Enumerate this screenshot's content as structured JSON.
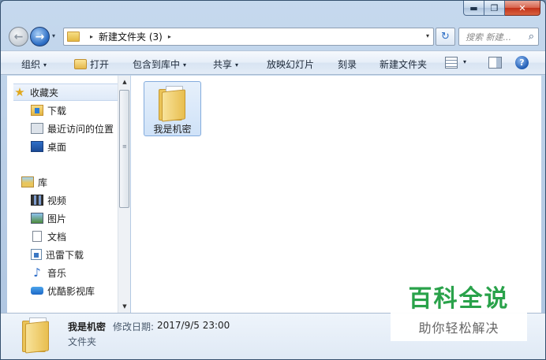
{
  "window": {
    "minimize_glyph": "▬",
    "maximize_glyph": "❐",
    "close_glyph": "✕"
  },
  "address_bar": {
    "path": "新建文件夹 (3)",
    "separator_glyph": "▸",
    "dropdown_glyph": "▾"
  },
  "search": {
    "placeholder": "搜索 新建..."
  },
  "toolbar": {
    "organize": "组织",
    "open": "打开",
    "include_in_library": "包含到库中",
    "share": "共享",
    "slideshow": "放映幻灯片",
    "burn": "刻录",
    "new_folder": "新建文件夹",
    "help_glyph": "?",
    "caret_glyph": "▾"
  },
  "nav_pane": {
    "favorites": {
      "label": "收藏夹",
      "items": [
        {
          "label": "下载",
          "icon": "download-folder-icon"
        },
        {
          "label": "最近访问的位置",
          "icon": "recent-places-icon"
        },
        {
          "label": "桌面",
          "icon": "desktop-icon"
        }
      ]
    },
    "libraries": {
      "label": "库",
      "items": [
        {
          "label": "视频",
          "icon": "video-library-icon"
        },
        {
          "label": "图片",
          "icon": "picture-library-icon"
        },
        {
          "label": "文档",
          "icon": "document-library-icon"
        },
        {
          "label": "迅雷下载",
          "icon": "thunder-download-icon"
        },
        {
          "label": "音乐",
          "icon": "music-library-icon"
        },
        {
          "label": "优酷影视库",
          "icon": "youku-library-icon"
        }
      ]
    }
  },
  "files": [
    {
      "name": "我是机密",
      "type": "folder",
      "selected": true
    }
  ],
  "details": {
    "name": "我是机密",
    "modified_label": "修改日期:",
    "modified_value": "2017/9/5 23:00",
    "type": "文件夹"
  },
  "watermark": {
    "title": "百科全说",
    "subtitle": "助你轻松解决"
  },
  "colors": {
    "frame": "#b6cbe4",
    "selection": "#cfe2f8",
    "watermark_green": "#29a24a"
  }
}
